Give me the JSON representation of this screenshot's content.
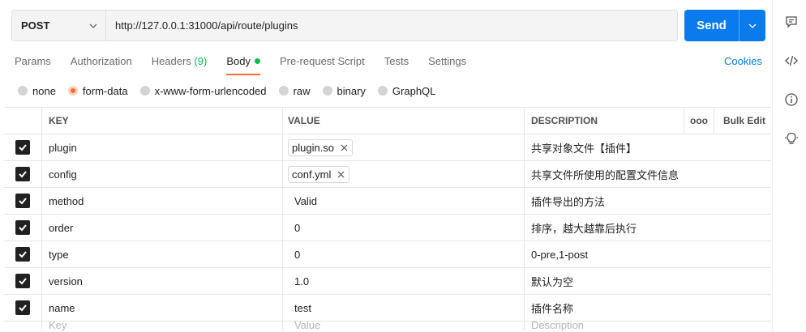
{
  "request": {
    "method": "POST",
    "url": "http://127.0.0.1:31000/api/route/plugins",
    "send_label": "Send"
  },
  "tabs": [
    {
      "label": "Params",
      "count": ""
    },
    {
      "label": "Authorization",
      "count": ""
    },
    {
      "label": "Headers",
      "count": "(9)"
    },
    {
      "label": "Body",
      "count": ""
    },
    {
      "label": "Pre-request Script",
      "count": ""
    },
    {
      "label": "Tests",
      "count": ""
    },
    {
      "label": "Settings",
      "count": ""
    }
  ],
  "active_tab": "Body",
  "cookies_label": "Cookies",
  "body_types": [
    {
      "label": "none",
      "selected": false
    },
    {
      "label": "form-data",
      "selected": true
    },
    {
      "label": "x-www-form-urlencoded",
      "selected": false
    },
    {
      "label": "raw",
      "selected": false
    },
    {
      "label": "binary",
      "selected": false
    },
    {
      "label": "GraphQL",
      "selected": false
    }
  ],
  "table": {
    "headers": {
      "key": "KEY",
      "value": "VALUE",
      "description": "DESCRIPTION",
      "more": "ooo",
      "bulk_edit": "Bulk Edit"
    },
    "rows": [
      {
        "checked": true,
        "key": "plugin",
        "value": "plugin.so",
        "value_is_file": true,
        "description": "共享对象文件【插件】"
      },
      {
        "checked": true,
        "key": "config",
        "value": "conf.yml",
        "value_is_file": true,
        "description": "共享文件所使用的配置文件信息"
      },
      {
        "checked": true,
        "key": "method",
        "value": "Valid",
        "value_is_file": false,
        "description": "插件导出的方法"
      },
      {
        "checked": true,
        "key": "order",
        "value": "0",
        "value_is_file": false,
        "description": "排序，越大越靠后执行"
      },
      {
        "checked": true,
        "key": "type",
        "value": "0",
        "value_is_file": false,
        "description": "0-pre,1-post"
      },
      {
        "checked": true,
        "key": "version",
        "value": "1.0",
        "value_is_file": false,
        "description": "默认为空"
      },
      {
        "checked": true,
        "key": "name",
        "value": "test",
        "value_is_file": false,
        "description": "插件名称"
      }
    ],
    "placeholders": {
      "key": "Key",
      "value": "Value",
      "description": "Description"
    }
  },
  "colors": {
    "accent": "#ff6c37",
    "send": "#097bed",
    "active_dot": "#0cbb52"
  },
  "icons": [
    "chevron-down-icon",
    "comment-icon",
    "code-icon",
    "info-icon",
    "lightbulb-icon",
    "check-icon",
    "close-icon"
  ]
}
